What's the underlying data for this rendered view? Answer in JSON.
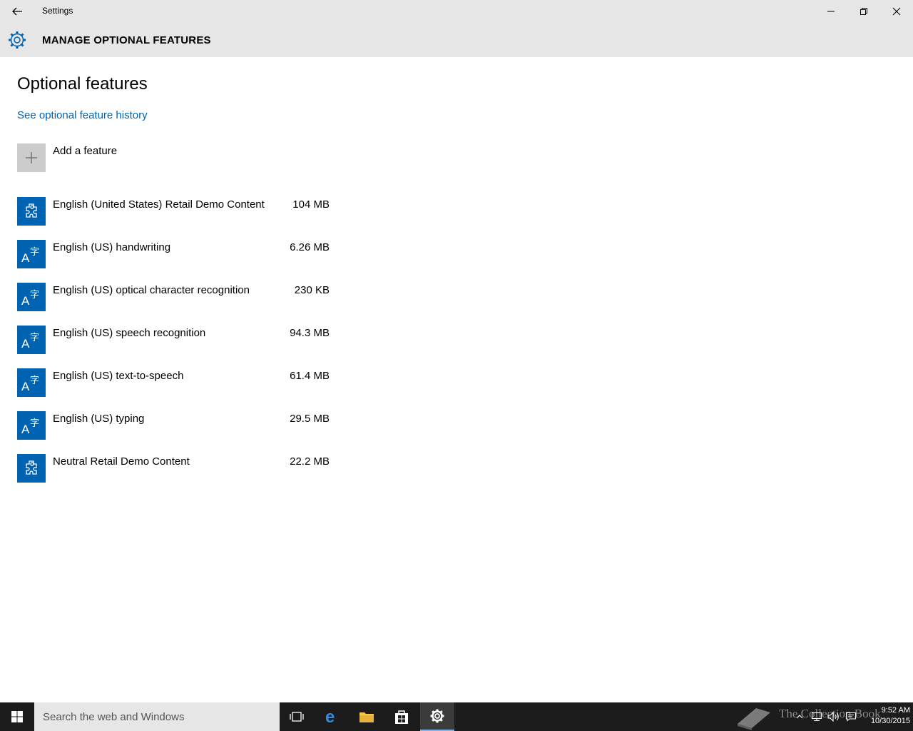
{
  "window": {
    "title": "Settings",
    "back_icon": "back-arrow-icon",
    "controls": [
      "minimize-icon",
      "restore-icon",
      "close-icon"
    ]
  },
  "header": {
    "icon": "gear-icon",
    "title": "MANAGE OPTIONAL FEATURES"
  },
  "main": {
    "page_title": "Optional features",
    "history_link": "See optional feature history",
    "add_feature_label": "Add a feature",
    "features": [
      {
        "name": "English (United States) Retail Demo Content",
        "size": "104 MB",
        "icon": "puzzle-icon"
      },
      {
        "name": "English (US) handwriting",
        "size": "6.26 MB",
        "icon": "language-icon"
      },
      {
        "name": "English (US) optical character recognition",
        "size": "230 KB",
        "icon": "language-icon"
      },
      {
        "name": "English (US) speech recognition",
        "size": "94.3 MB",
        "icon": "language-icon"
      },
      {
        "name": "English (US) text-to-speech",
        "size": "61.4 MB",
        "icon": "language-icon"
      },
      {
        "name": "English (US) typing",
        "size": "29.5 MB",
        "icon": "language-icon"
      },
      {
        "name": "Neutral Retail Demo Content",
        "size": "22.2 MB",
        "icon": "puzzle-icon"
      }
    ]
  },
  "taskbar": {
    "search_placeholder": "Search the web and Windows",
    "apps": [
      "task-view-icon",
      "edge-icon",
      "file-explorer-icon",
      "store-icon",
      "settings-icon"
    ],
    "watermark": "The Collection Book",
    "time": "9:52 AM",
    "date": "10/30/2015"
  },
  "colors": {
    "accent": "#0063b1",
    "chrome": "#e6e6e6",
    "taskbar": "#1c1c1c"
  }
}
